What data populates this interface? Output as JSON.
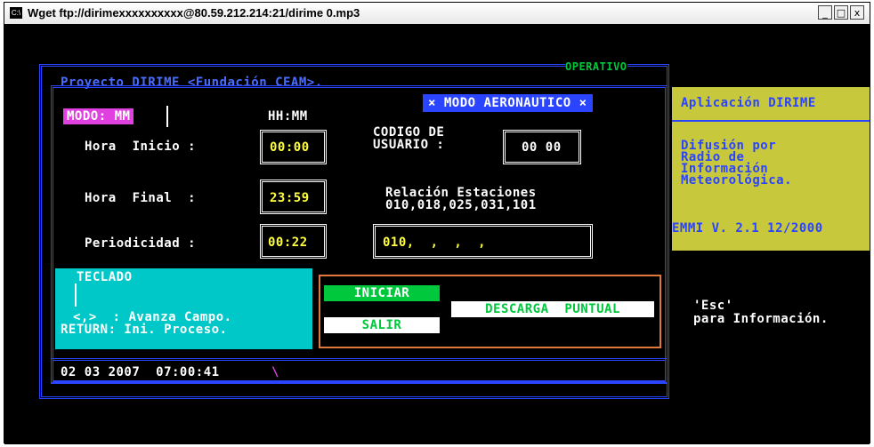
{
  "window": {
    "title": "Wget ftp://dirimexxxxxxxxxx@80.59.212.214:21/dirime  0.mp3",
    "icon_text": "C:\\",
    "minimize": "_",
    "maximize": "□",
    "close": "x"
  },
  "screen": {
    "status": "OPERATIVO",
    "project": "Proyecto DIRIME <Fundación CEAM>.",
    "mode_badge": "MODO: MM",
    "clock_format": "HH:MM",
    "aero_banner": "× MODO AERONAUTICO ×",
    "hora_inicio_label": "Hora  Inicio :",
    "hora_inicio_value": "00:00",
    "hora_final_label": "Hora  Final  :",
    "hora_final_value": "23:59",
    "periodicidad_label": "Periodicidad :",
    "periodicidad_value": "00:22",
    "codigo_label_1": "CODIGO DE",
    "codigo_label_2": "USUARIO :",
    "codigo_value": "00 00",
    "relacion_label": "Relación Estaciones",
    "relacion_list": "010,018,025,031,101",
    "estaciones_input": "010,  ,  ,  ,  ",
    "teclado_title": "TECLADO",
    "teclado_line1": "<,>  : Avanza Campo.",
    "teclado_line2": "RETURN: Ini. Proceso.",
    "btn_iniciar": "INICIAR",
    "btn_salir": "SALIR",
    "btn_descarga": "DESCARGA  PUNTUAL",
    "status_line": "02 03 2007  07:00:41",
    "spinner": "\\",
    "side_title": "Aplicación DIRIME",
    "side_desc_1": "Difusión por",
    "side_desc_2": "Radio de",
    "side_desc_3": "Información",
    "side_desc_4": "Meteorológica.",
    "side_version": "EMMI V. 2.1 12/2000",
    "esc_hint_1": "'Esc'",
    "esc_hint_2": "para Información."
  },
  "colors": {
    "bg": "#000000",
    "frame_blue": "#2a44ff",
    "project_blue": "#4a6cff",
    "green": "#00c83c",
    "yellow": "#ffff3c",
    "magenta": "#e040e0",
    "panel_yellow": "#c8c83c",
    "panel_cyan": "#00c8c8",
    "orange": "#e0783c"
  }
}
